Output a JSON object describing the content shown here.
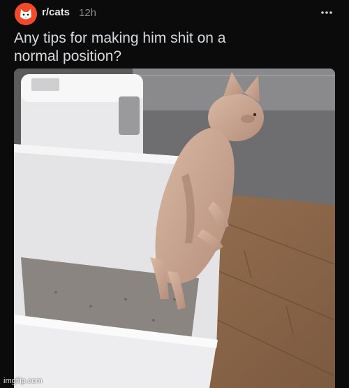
{
  "post": {
    "subreddit": "r/cats",
    "time": "12h",
    "title": "Any tips for making him shit on a normal position?"
  },
  "icons": {
    "avatar": "subreddit-cat-avatar",
    "more": "more-horizontal-icon"
  },
  "watermark": "imgflip.com",
  "colors": {
    "background": "#0b0b0b",
    "avatar": "#f04a2a",
    "title": "#d8dadd",
    "meta": "#8a8a8a"
  }
}
